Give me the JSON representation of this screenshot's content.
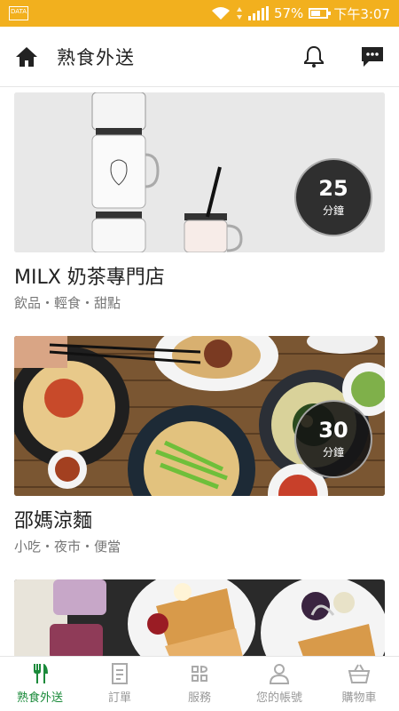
{
  "status_bar": {
    "data_label": "DATA",
    "battery": "57%",
    "time": "下午3:07"
  },
  "header": {
    "title": "熟食外送",
    "icons": [
      "home-icon",
      "bell-icon",
      "chat-icon"
    ]
  },
  "restaurants": [
    {
      "name": "MILX 奶茶專門店",
      "tags": "飲品・輕食・甜點",
      "time": "25",
      "unit": "分鐘"
    },
    {
      "name": "邵媽涼麵",
      "tags": "小吃・夜市・便當",
      "time": "30",
      "unit": "分鐘"
    }
  ],
  "tabs": [
    {
      "label": "熟食外送",
      "icon": "fork-knife-icon",
      "active": true
    },
    {
      "label": "訂單",
      "icon": "receipt-icon",
      "active": false
    },
    {
      "label": "服務",
      "icon": "services-icon",
      "active": false
    },
    {
      "label": "您的帳號",
      "icon": "user-icon",
      "active": false
    },
    {
      "label": "購物車",
      "icon": "basket-icon",
      "active": false
    }
  ],
  "colors": {
    "status_bar": "#f2b01e",
    "active_tab": "#1a8a3a"
  }
}
